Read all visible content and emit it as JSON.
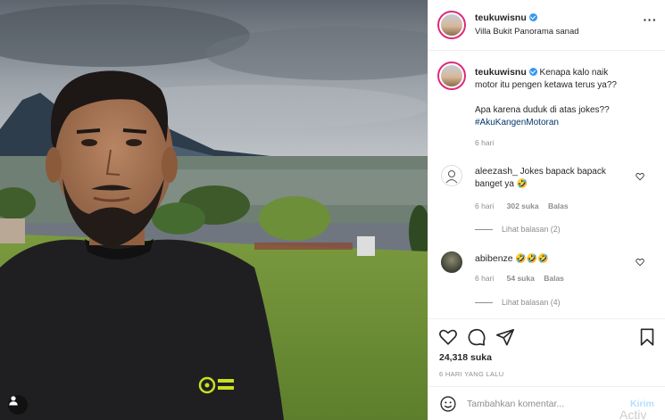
{
  "header": {
    "username": "teukuwisnu",
    "location": "Villa Bukit Panorama sanad",
    "more_icon": "three-dots-icon"
  },
  "caption": {
    "username": "teukuwisnu",
    "line1": "Kenapa kalo naik",
    "line2": "motor itu pengen ketawa terus ya??",
    "line3": "Apa karena duduk di atas jokes??",
    "hashtag": "#AkuKangenMotoran",
    "time": "6 hari"
  },
  "comments": [
    {
      "username": "aleezash_",
      "text_first": "Jokes bapack bapack",
      "text_second": "banget ya 🤣",
      "time": "6 hari",
      "likes": "302 suka",
      "reply": "Balas",
      "view_replies": "Lihat balasan (2)"
    },
    {
      "username": "abibenze",
      "text_first": "🤣🤣🤣",
      "time": "6 hari",
      "likes": "54 suka",
      "reply": "Balas",
      "view_replies": "Lihat balasan (4)"
    }
  ],
  "actions": {
    "like_icon": "heart-icon",
    "comment_icon": "comment-icon",
    "share_icon": "paper-plane-icon",
    "save_icon": "bookmark-icon",
    "likes_count": "24,318 suka",
    "date": "6 HARI YANG LALU"
  },
  "add_comment": {
    "placeholder": "Tambahkan komentar...",
    "post_label": "Kirim",
    "watermark": "Activ"
  },
  "colors": {
    "verified": "#3897f0",
    "hashtag": "#00376b",
    "muted": "#8e8e8e",
    "post_button": "#b2dffc"
  }
}
